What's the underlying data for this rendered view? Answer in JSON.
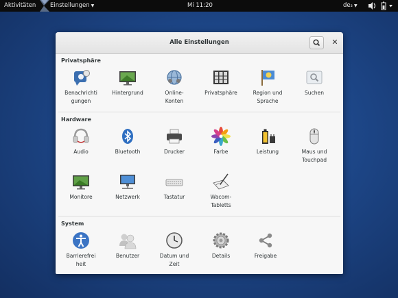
{
  "topbar": {
    "activities": "Aktivitäten",
    "app_menu": "Einstellungen",
    "clock": "Mi 11:20",
    "keyboard_layout": "de₂"
  },
  "window": {
    "title": "Alle Einstellungen",
    "sections": [
      {
        "title": "Privatsphäre",
        "items": [
          {
            "label_lines": [
              "Benachrichti",
              "gungen"
            ],
            "icon": "notifications-icon"
          },
          {
            "label_lines": [
              "Hintergrund"
            ],
            "icon": "background-icon"
          },
          {
            "label_lines": [
              "Online-",
              "Konten"
            ],
            "icon": "online-accounts-icon"
          },
          {
            "label_lines": [
              "Privatsphäre"
            ],
            "icon": "privacy-icon"
          },
          {
            "label_lines": [
              "Region und",
              "Sprache"
            ],
            "icon": "region-language-icon"
          },
          {
            "label_lines": [
              "Suchen"
            ],
            "icon": "search-settings-icon"
          }
        ]
      },
      {
        "title": "Hardware",
        "items": [
          {
            "label_lines": [
              "Audio"
            ],
            "icon": "audio-icon"
          },
          {
            "label_lines": [
              "Bluetooth"
            ],
            "icon": "bluetooth-icon"
          },
          {
            "label_lines": [
              "Drucker"
            ],
            "icon": "printer-icon"
          },
          {
            "label_lines": [
              "Farbe"
            ],
            "icon": "color-icon"
          },
          {
            "label_lines": [
              "Leistung"
            ],
            "icon": "power-icon"
          },
          {
            "label_lines": [
              "Maus und",
              "Touchpad"
            ],
            "icon": "mouse-icon"
          },
          {
            "label_lines": [
              "Monitore"
            ],
            "icon": "display-icon"
          },
          {
            "label_lines": [
              "Netzwerk"
            ],
            "icon": "network-icon"
          },
          {
            "label_lines": [
              "Tastatur"
            ],
            "icon": "keyboard-icon"
          },
          {
            "label_lines": [
              "Wacom-",
              "Tabletts"
            ],
            "icon": "wacom-icon"
          }
        ]
      },
      {
        "title": "System",
        "items": [
          {
            "label_lines": [
              "Barrierefrei",
              "heit"
            ],
            "icon": "accessibility-icon"
          },
          {
            "label_lines": [
              "Benutzer"
            ],
            "icon": "users-icon"
          },
          {
            "label_lines": [
              "Datum und",
              "Zeit"
            ],
            "icon": "date-time-icon"
          },
          {
            "label_lines": [
              "Details"
            ],
            "icon": "details-icon"
          },
          {
            "label_lines": [
              "Freigabe"
            ],
            "icon": "sharing-icon"
          }
        ]
      }
    ]
  }
}
